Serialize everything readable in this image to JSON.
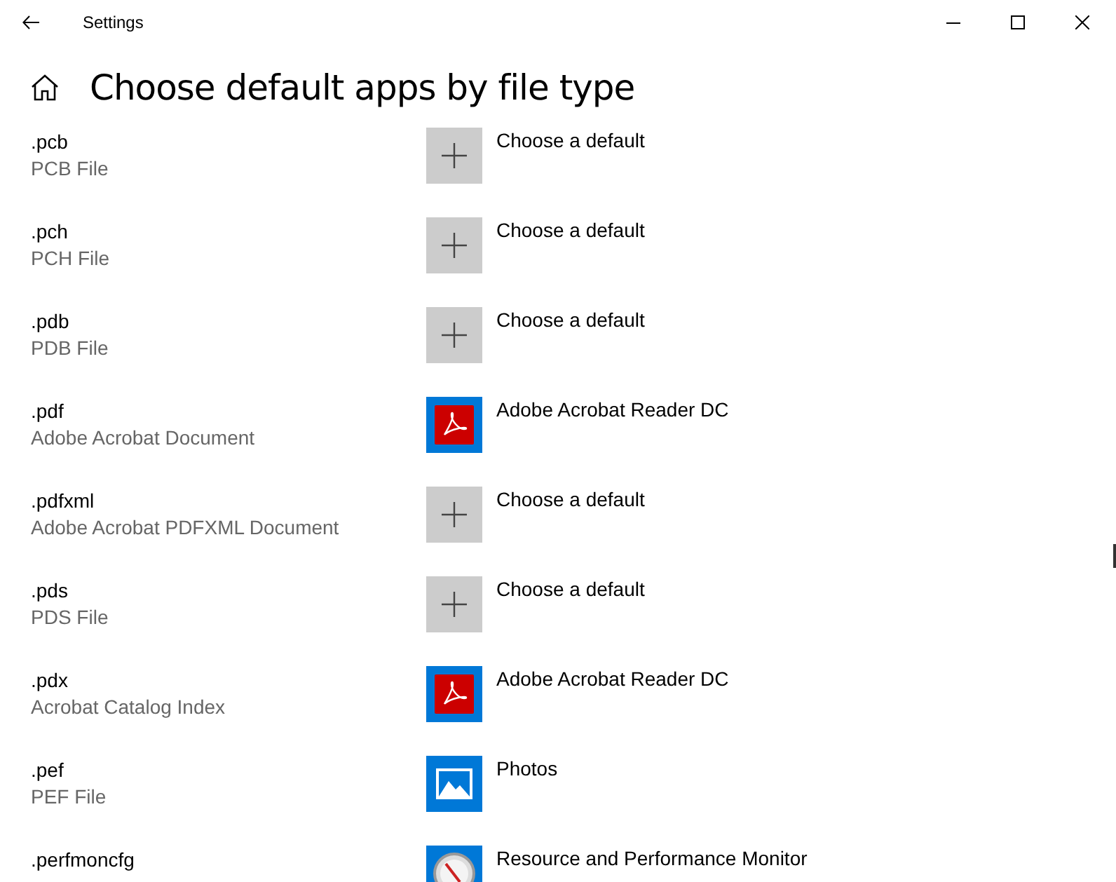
{
  "window": {
    "title": "Settings"
  },
  "page": {
    "title": "Choose default apps by file type"
  },
  "rows": [
    {
      "extension": ".pcb",
      "description": "PCB File",
      "app": {
        "kind": "add",
        "name": "Choose a default"
      }
    },
    {
      "extension": ".pch",
      "description": "PCH File",
      "app": {
        "kind": "add",
        "name": "Choose a default"
      }
    },
    {
      "extension": ".pdb",
      "description": "PDB File",
      "app": {
        "kind": "add",
        "name": "Choose a default"
      }
    },
    {
      "extension": ".pdf",
      "description": "Adobe Acrobat Document",
      "app": {
        "kind": "acrobat",
        "name": "Adobe Acrobat Reader DC"
      }
    },
    {
      "extension": ".pdfxml",
      "description": "Adobe Acrobat PDFXML Document",
      "app": {
        "kind": "add",
        "name": "Choose a default"
      }
    },
    {
      "extension": ".pds",
      "description": "PDS File",
      "app": {
        "kind": "add",
        "name": "Choose a default"
      }
    },
    {
      "extension": ".pdx",
      "description": "Acrobat Catalog Index",
      "app": {
        "kind": "acrobat",
        "name": "Adobe Acrobat Reader DC"
      }
    },
    {
      "extension": ".pef",
      "description": "PEF File",
      "app": {
        "kind": "photos",
        "name": "Photos"
      }
    },
    {
      "extension": ".perfmoncfg",
      "app": {
        "kind": "monitor",
        "name": "Resource and Performance Monitor"
      }
    }
  ]
}
